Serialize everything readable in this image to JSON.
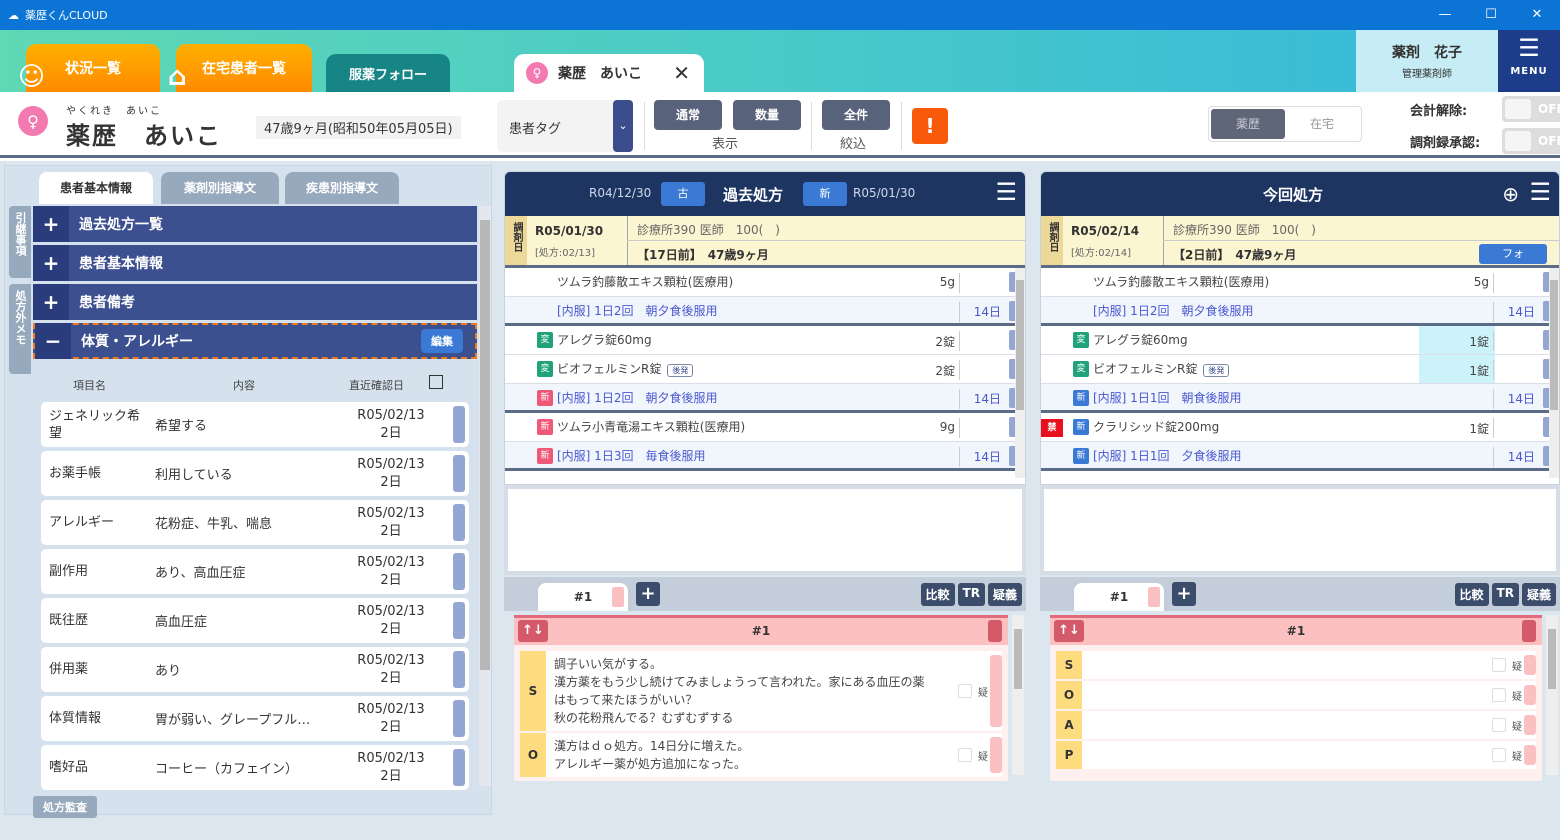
{
  "window": {
    "title": "薬歴くんCLOUD",
    "controls": {
      "minimize": "—",
      "maximize": "☐",
      "close": "✕"
    }
  },
  "nav": {
    "tabs": [
      {
        "label": "状況一覧",
        "icon": "people-icon"
      },
      {
        "label": "在宅患者一覧",
        "icon": "home-patient-icon"
      },
      {
        "label": "服薬フォロー"
      }
    ],
    "patient_tab": {
      "label": "薬歴　あいこ",
      "close": "✕"
    }
  },
  "user": {
    "name": "薬剤　花子",
    "role": "管理薬剤師"
  },
  "menu": {
    "label": "MENU",
    "icon": "☰"
  },
  "patient": {
    "kana": "やくれき　あいこ",
    "name": "薬歴　あいこ",
    "age": "47歳9ヶ月(昭和50年05月05日)",
    "tag_select": "患者タグ",
    "display_buttons": [
      "通常",
      "数量"
    ],
    "display_label": "表示",
    "filter_button": "全件",
    "filter_label": "絞込",
    "warning": "!",
    "mode_segments": [
      "薬歴",
      "在宅"
    ],
    "toggles": [
      {
        "label": "会計解除:",
        "value": "OFF"
      },
      {
        "label": "調剤録承認:",
        "value": "OFF"
      }
    ]
  },
  "left": {
    "tabs": [
      "患者基本情報",
      "薬剤別指導文",
      "疾患別指導文"
    ],
    "side_tabs": [
      "引継事項",
      "処方外メモ"
    ],
    "sections": [
      {
        "label": "過去処方一覧",
        "toggle": "+"
      },
      {
        "label": "患者基本情報",
        "toggle": "+"
      },
      {
        "label": "患者備考",
        "toggle": "+"
      },
      {
        "label": "体質・アレルギー",
        "toggle": "−",
        "edit": "編集"
      }
    ],
    "columns": [
      "項目名",
      "内容",
      "直近確認日"
    ],
    "rows": [
      {
        "key": "ジェネリック希望",
        "value": "希望する",
        "date": "R05/02/13",
        "ago": "2日"
      },
      {
        "key": "お薬手帳",
        "value": "利用している",
        "date": "R05/02/13",
        "ago": "2日"
      },
      {
        "key": "アレルギー",
        "value": "花粉症、牛乳、喘息",
        "date": "R05/02/13",
        "ago": "2日"
      },
      {
        "key": "副作用",
        "value": "あり、高血圧症",
        "date": "R05/02/13",
        "ago": "2日"
      },
      {
        "key": "既往歴",
        "value": "高血圧症",
        "date": "R05/02/13",
        "ago": "2日"
      },
      {
        "key": "併用薬",
        "value": "あり",
        "date": "R05/02/13",
        "ago": "2日"
      },
      {
        "key": "体質情報",
        "value": "胃が弱い、グレープフル…",
        "date": "R05/02/13",
        "ago": "2日"
      },
      {
        "key": "嗜好品",
        "value": "コーヒー（カフェイン）",
        "date": "R05/02/13",
        "ago": "2日"
      }
    ],
    "audit_button": "処方監査"
  },
  "past": {
    "title": "過去処方",
    "prev_date": "R04/12/30",
    "prev_btn": "古",
    "next_btn": "新",
    "next_date": "R05/01/30",
    "dispense_label": "調剤日",
    "date": "R05/01/30",
    "rx_date": "[処方:02/13]",
    "clinic": "診療所390 医師　100(　)",
    "elapsed": "【17日前】　47歳9ヶ月",
    "drugs": [
      {
        "type": "drug",
        "name": "ツムラ釣藤散エキス顆粒(医療用)",
        "qty": "5g"
      },
      {
        "type": "usage",
        "name": "[内服] 1日2回　朝夕食後服用",
        "days": "14日",
        "group_end": true
      },
      {
        "type": "drug",
        "badge": "変",
        "badge_color": "g",
        "name": "アレグラ錠60mg",
        "qty": "2錠"
      },
      {
        "type": "drug",
        "badge": "変",
        "badge_color": "g",
        "name": "ビオフェルミンR錠",
        "generic": "後発",
        "qty": "2錠"
      },
      {
        "type": "usage",
        "badge": "新",
        "badge_color": "r",
        "name": "[内服] 1日2回　朝夕食後服用",
        "days": "14日",
        "group_end": true
      },
      {
        "type": "drug",
        "badge": "新",
        "badge_color": "r",
        "name": "ツムラ小青竜湯エキス顆粒(医療用)",
        "qty": "9g"
      },
      {
        "type": "usage",
        "badge": "新",
        "badge_color": "r",
        "name": "[内服] 1日3回　毎食後服用",
        "days": "14日",
        "group_end": true
      }
    ],
    "soap_tab": "#1",
    "soap_header": "#1",
    "soap": [
      {
        "letter": "S",
        "text": "調子いい気がする。\n漢方薬をもう少し続けてみましょうって言われた。家にある血圧の薬はもって来たほうがいい？\n秋の花粉飛んでる？むずむずする",
        "q": "疑"
      },
      {
        "letter": "O",
        "text": "漢方はｄｏ処方。14日分に増えた。\nアレルギー薬が処方追加になった。",
        "q": "疑"
      }
    ]
  },
  "current": {
    "title": "今回処方",
    "dispense_label": "調剤日",
    "date": "R05/02/14",
    "rx_date": "[処方:02/14]",
    "clinic": "診療所390 医師　100(　)",
    "elapsed": "【2日前】　47歳9ヶ月",
    "follow_btn": "フォ",
    "drugs": [
      {
        "type": "drug",
        "name": "ツムラ釣藤散エキス顆粒(医療用)",
        "qty": "5g"
      },
      {
        "type": "usage",
        "name": "[内服] 1日2回　朝夕食後服用",
        "days": "14日",
        "group_end": true
      },
      {
        "type": "drug",
        "badge": "変",
        "badge_color": "g",
        "name": "アレグラ錠60mg",
        "qty": "1錠",
        "highlight": true
      },
      {
        "type": "drug",
        "badge": "変",
        "badge_color": "g",
        "name": "ビオフェルミンR錠",
        "generic": "後発",
        "qty": "1錠",
        "highlight": true
      },
      {
        "type": "usage",
        "badge": "新",
        "badge_color": "b",
        "name": "[内服] 1日1回　朝食後服用",
        "days": "14日",
        "group_end": true
      },
      {
        "type": "drug",
        "kin": "禁",
        "badge": "新",
        "badge_color": "b",
        "name": "クラリシッド錠200mg",
        "qty": "1錠"
      },
      {
        "type": "usage",
        "badge": "新",
        "badge_color": "b",
        "name": "[内服] 1日1回　夕食後服用",
        "days": "14日",
        "group_end": true
      }
    ],
    "soap_tab": "#1",
    "soap_header": "#1",
    "soap": [
      {
        "letter": "S",
        "text": "",
        "q": "疑"
      },
      {
        "letter": "O",
        "text": "",
        "q": "疑"
      },
      {
        "letter": "A",
        "text": "",
        "q": "疑"
      },
      {
        "letter": "P",
        "text": "",
        "q": "疑"
      }
    ]
  },
  "soap_buttons": [
    "比較",
    "TR",
    "疑義"
  ],
  "soap_add": "+",
  "soap_sort": "↑↓"
}
